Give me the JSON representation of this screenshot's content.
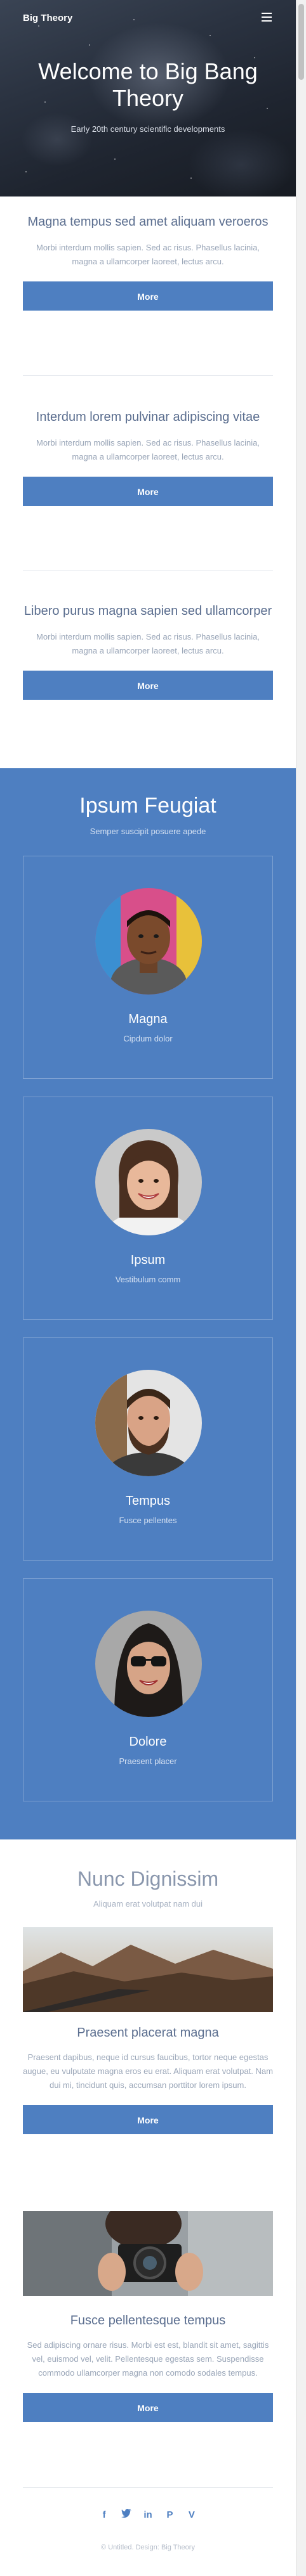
{
  "header": {
    "brand": "Big Theory",
    "menu_icon": "hamburger-menu-icon",
    "title": "Welcome to Big Bang Theory",
    "subtitle": "Early 20th century scientific developments"
  },
  "features": [
    {
      "title": "Magna tempus sed amet aliquam veroeros",
      "text": "Morbi interdum mollis sapien. Sed ac risus. Phasellus lacinia, magna a ullamcorper laoreet, lectus arcu.",
      "button": "More"
    },
    {
      "title": "Interdum lorem pulvinar adipiscing vitae",
      "text": "Morbi interdum mollis sapien. Sed ac risus. Phasellus lacinia, magna a ullamcorper laoreet, lectus arcu.",
      "button": "More"
    },
    {
      "title": "Libero purus magna sapien sed ullamcorper",
      "text": "Morbi interdum mollis sapien. Sed ac risus. Phasellus lacinia, magna a ullamcorper laoreet, lectus arcu.",
      "button": "More"
    }
  ],
  "team": {
    "title": "Ipsum Feugiat",
    "subtitle": "Semper suscipit posuere apede",
    "members": [
      {
        "name": "Magna",
        "role": "Cipdum dolor"
      },
      {
        "name": "Ipsum",
        "role": "Vestibulum comm"
      },
      {
        "name": "Tempus",
        "role": "Fusce pellentes"
      },
      {
        "name": "Dolore",
        "role": "Praesent placer"
      }
    ]
  },
  "gallery": {
    "title": "Nunc Dignissim",
    "subtitle": "Aliquam erat volutpat nam dui",
    "posts": [
      {
        "title": "Praesent placerat magna",
        "text": "Praesent dapibus, neque id cursus faucibus, tortor neque egestas augue, eu vulputate magna eros eu erat. Aliquam erat volutpat. Nam dui mi, tincidunt quis, accumsan porttitor lorem ipsum.",
        "button": "More"
      },
      {
        "title": "Fusce pellentesque tempus",
        "text": "Sed adipiscing ornare risus. Morbi est est, blandit sit amet, sagittis vel, euismod vel, velit. Pellentesque egestas sem. Suspendisse commodo ullamcorper magna non comodo sodales tempus.",
        "button": "More"
      }
    ]
  },
  "footer": {
    "social_icons": [
      "facebook-icon",
      "twitter-icon",
      "linkedin-icon",
      "pinterest-icon",
      "vimeo-icon"
    ],
    "copyright": "© Untitled. Design: Big Theory"
  },
  "colors": {
    "accent": "#4e7fc1",
    "heading": "#5b6e8f",
    "text": "#9aa6b8"
  }
}
